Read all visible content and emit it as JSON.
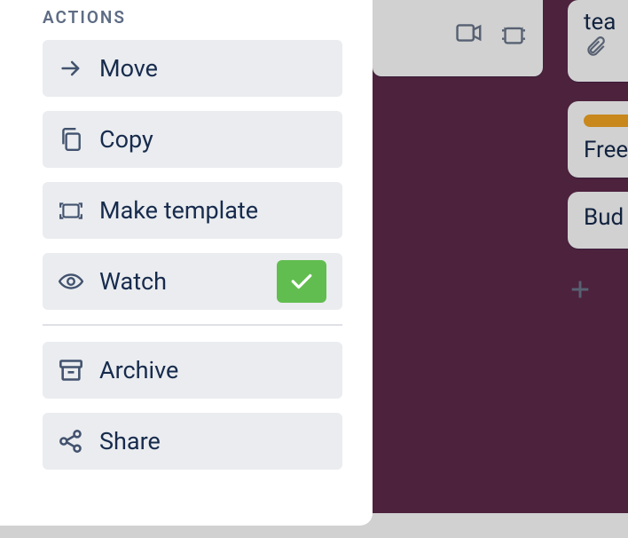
{
  "panel": {
    "heading": "ACTIONS",
    "move": "Move",
    "copy": "Copy",
    "make_template": "Make template",
    "watch": "Watch",
    "archive": "Archive",
    "share": "Share"
  },
  "cards": {
    "c2_text": "tea",
    "c3_text": "Free",
    "c4_text": "Bud"
  }
}
